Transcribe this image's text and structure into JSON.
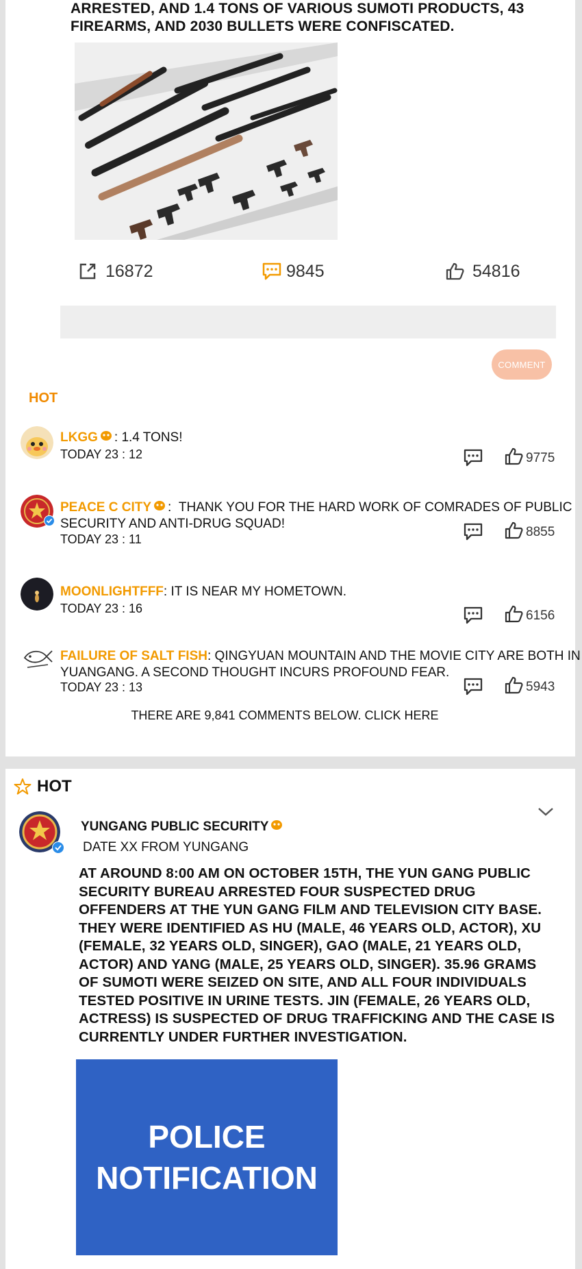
{
  "top_post": {
    "text": "ARRESTED, AND 1.4 TONS OF VARIOUS SUMOTI PRODUCTS, 43 FIREARMS, AND 2030 BULLETS WERE CONFISCATED.",
    "image_icon": "confiscated-firearms-photo",
    "actions": {
      "repost_count": "16872",
      "comment_count": "9845",
      "like_count": "54816"
    }
  },
  "comment_button_label": "COMMENT",
  "hot_label": "HOT",
  "comments": [
    {
      "name": "LKGG",
      "text": ": 1.4 TONS!",
      "time": "TODAY 23 : 12",
      "likes": "9775"
    },
    {
      "name": "PEACE C CITY",
      "text": ":  THANK YOU FOR THE HARD WORK OF COMRADES OF PUBLIC SECURITY AND ANTI-DRUG SQUAD!",
      "time": "TODAY 23 : 11",
      "likes": "8855"
    },
    {
      "name": "MOONLIGHTFFF",
      "text": ": IT IS NEAR MY HOMETOWN.",
      "time": "TODAY 23 : 16",
      "likes": "6156"
    },
    {
      "name": "FAILURE OF SALT FISH",
      "text": ": QINGYUAN MOUNTAIN AND THE MOVIE CITY ARE BOTH IN YUANGANG. A SECOND THOUGHT INCURS PROFOUND FEAR.",
      "time": "TODAY 23 : 13",
      "likes": "5943"
    }
  ],
  "more_comments_link": "THERE ARE 9,841 COMMENTS BELOW. CLICK HERE",
  "hot_section": {
    "title": "HOT",
    "author": "YUNGANG PUBLIC SECURITY",
    "date": "DATE XX FROM YUNGANG",
    "body": "AT AROUND 8:00 AM ON OCTOBER 15TH, THE YUN GANG PUBLIC SECURITY BUREAU ARRESTED FOUR SUSPECTED DRUG OFFENDERS AT THE YUN GANG FILM AND TELEVISION CITY BASE. THEY WERE IDENTIFIED AS HU (MALE, 46 YEARS OLD, ACTOR), XU (FEMALE, 32 YEARS OLD, SINGER), GAO (MALE, 21 YEARS OLD, ACTOR) AND YANG (MALE, 25 YEARS OLD, SINGER). 35.96 GRAMS OF SUMOTI WERE SEIZED ON SITE, AND ALL FOUR INDIVIDUALS TESTED POSITIVE IN URINE TESTS. JIN (FEMALE, 26 YEARS OLD, ACTRESS) IS SUSPECTED OF DRUG TRAFFICKING AND THE CASE IS CURRENTLY UNDER FURTHER INVESTIGATION.",
    "image_line1": "POLICE",
    "image_line2": "NOTIFICATION"
  },
  "colors": {
    "accent_orange": "#f29a00",
    "comment_button": "#f8c1a6",
    "notification_blue": "#2f62c4"
  }
}
